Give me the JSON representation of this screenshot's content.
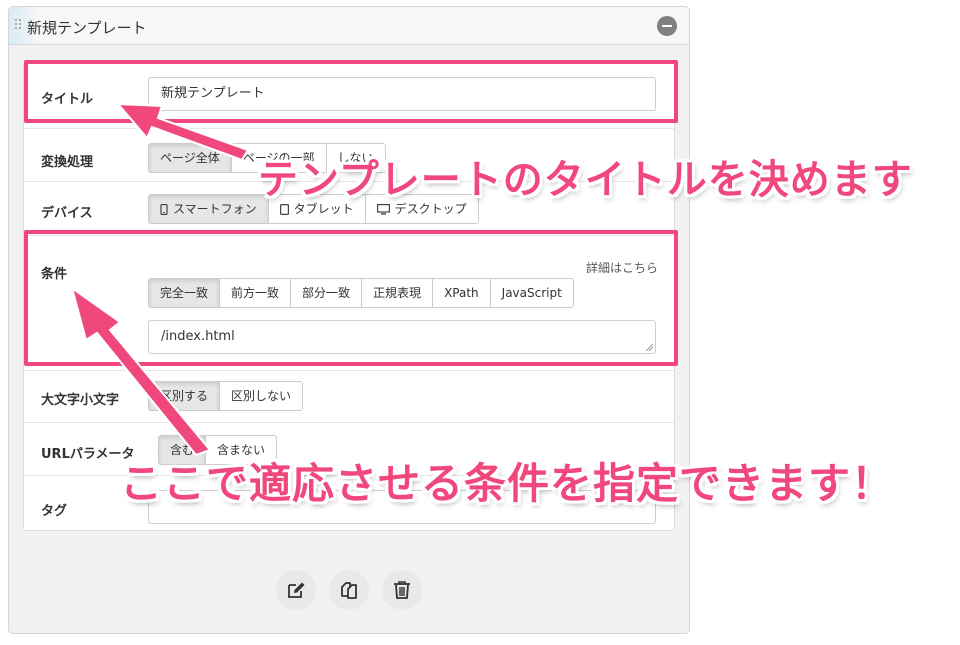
{
  "panel": {
    "title": "新規テンプレート"
  },
  "form": {
    "title_row": {
      "label": "タイトル",
      "value": "新規テンプレート"
    },
    "transform_row": {
      "label": "変換処理",
      "options": [
        "ページ全体",
        "ページの一部",
        "しない"
      ]
    },
    "device_row": {
      "label": "デバイス",
      "options": [
        "スマートフォン",
        "タブレット",
        "デスクトップ"
      ]
    },
    "condition_row": {
      "label": "条件",
      "detail_link": "詳細はこちら",
      "match_options": [
        "完全一致",
        "前方一致",
        "部分一致",
        "正規表現",
        "XPath",
        "JavaScript"
      ],
      "value": "/index.html"
    },
    "case_row": {
      "label": "大文字小文字",
      "options": [
        "区別する",
        "区別しない"
      ]
    },
    "urlparam_row": {
      "label": "URLパラメータ",
      "options": [
        "含む",
        "含まない"
      ]
    },
    "tag_row": {
      "label": "タグ",
      "value": ""
    }
  },
  "callouts": {
    "title_note": "テンプレートのタイトルを決めます",
    "condition_note": "ここで適応させる条件を指定できます！"
  },
  "colors": {
    "highlight": "#f0487d",
    "active_button": "#e6e6e6",
    "panel_bg": "#f1f1f1"
  },
  "icons": [
    "grip-icon",
    "collapse-icon",
    "smartphone-icon",
    "tablet-icon",
    "desktop-icon",
    "edit-icon",
    "copy-icon",
    "trash-icon"
  ]
}
